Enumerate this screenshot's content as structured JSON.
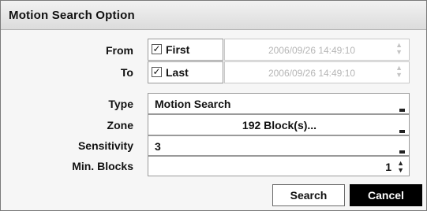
{
  "dialog": {
    "title": "Motion Search Option"
  },
  "range": {
    "from_label": "From",
    "to_label": "To",
    "first_label": "First",
    "last_label": "Last",
    "first_checked": true,
    "last_checked": true,
    "from_datetime": "2006/09/26  14:49:10",
    "to_datetime": "2006/09/26  14:49:10"
  },
  "fields": {
    "type_label": "Type",
    "type_value": "Motion Search",
    "zone_label": "Zone",
    "zone_value": "192 Block(s)...",
    "sensitivity_label": "Sensitivity",
    "sensitivity_value": "3",
    "min_blocks_label": "Min. Blocks",
    "min_blocks_value": "1"
  },
  "buttons": {
    "search": "Search",
    "cancel": "Cancel"
  },
  "icons": {
    "checkbox_mark": "✓",
    "spinner_up": "▲",
    "spinner_down": "▼",
    "dropdown": "dropdown-arrow-icon"
  },
  "colors": {
    "cancel_bg": "#000000",
    "cancel_fg": "#ffffff",
    "disabled_text": "#b6b6b6"
  }
}
